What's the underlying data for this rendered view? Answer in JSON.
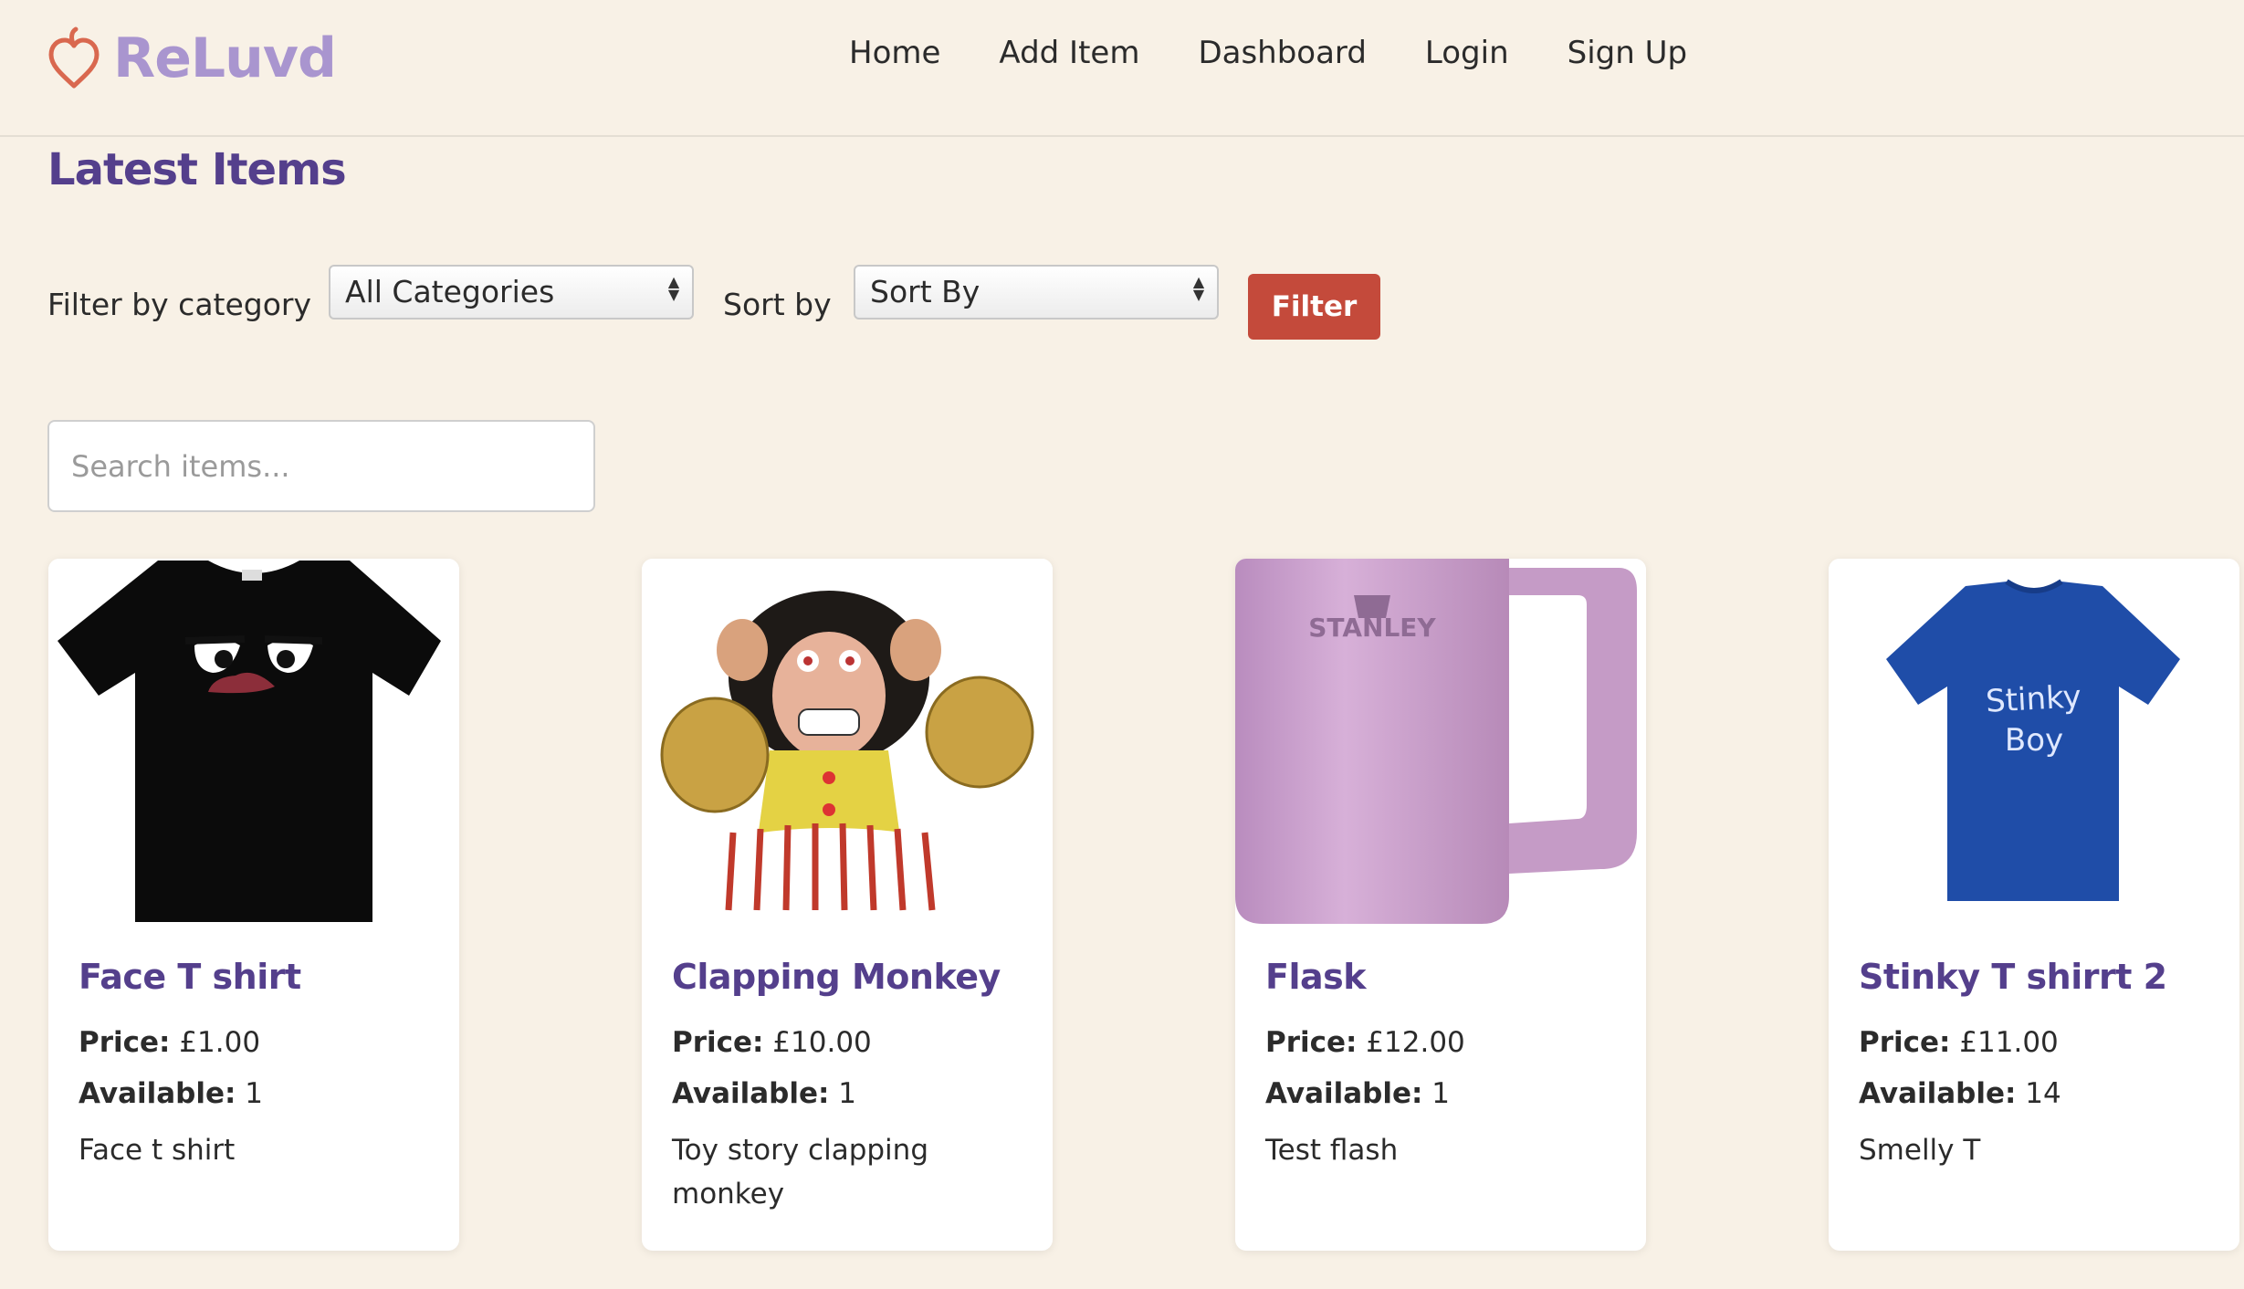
{
  "brand": {
    "name": "ReLuvd",
    "color": "#a995cf",
    "icon": "heart-icon"
  },
  "nav": {
    "items": [
      "Home",
      "Add Item",
      "Dashboard",
      "Login",
      "Sign Up"
    ]
  },
  "page": {
    "title": "Latest Items"
  },
  "filters": {
    "category_label": "Filter by category",
    "category_selected": "All Categories",
    "sort_label": "Sort by",
    "sort_selected": "Sort By",
    "filter_button": "Filter"
  },
  "search": {
    "placeholder": "Search items..."
  },
  "items": [
    {
      "title": "Face T shirt",
      "price_label": "Price:",
      "price": "£1.00",
      "available_label": "Available:",
      "available": "1",
      "description": "Face t shirt",
      "image": "black-t-shirt-image"
    },
    {
      "title": "Clapping Monkey",
      "price_label": "Price:",
      "price": "£10.00",
      "available_label": "Available:",
      "available": "1",
      "description": "Toy story clapping monkey",
      "image": "monkey-toy-image"
    },
    {
      "title": "Flask",
      "price_label": "Price:",
      "price": "£12.00",
      "available_label": "Available:",
      "available": "1",
      "description": "Test flash",
      "image": "pink-flask-image"
    },
    {
      "title": "Stinky T shirrt 2",
      "price_label": "Price:",
      "price": "£11.00",
      "available_label": "Available:",
      "available": "14",
      "description": "Smelly T",
      "image": "blue-t-shirt-image"
    }
  ],
  "colors": {
    "accent": "#543f8c",
    "button": "#c44a3b",
    "background": "#f8f1e6"
  }
}
